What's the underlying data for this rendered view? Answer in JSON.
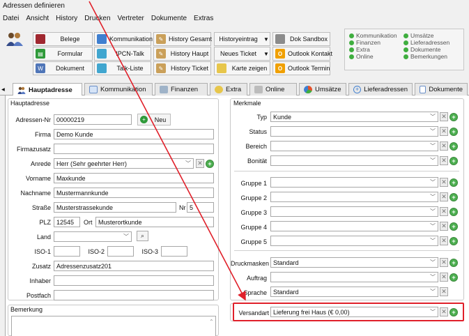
{
  "window": {
    "title": "Adressen definieren"
  },
  "menu": [
    "Datei",
    "Ansicht",
    "History",
    "Drucken",
    "Vertreter",
    "Dokumente",
    "Extras"
  ],
  "toolbar": {
    "buttons": [
      {
        "label": "Belege",
        "icon": "book-icon"
      },
      {
        "label": "Formular",
        "icon": "printer-icon"
      },
      {
        "label": "Dokument",
        "icon": "document-icon"
      },
      {
        "label": "Kommunikation",
        "icon": "communication-icon"
      },
      {
        "label": "IPCN-Talk",
        "icon": "talk-icon"
      },
      {
        "label": "Talk-Liste",
        "icon": "list-icon"
      },
      {
        "label": "History Gesamt",
        "icon": "pen-icon"
      },
      {
        "label": "History Haupt",
        "icon": "pen-icon"
      },
      {
        "label": "History Ticket",
        "icon": "pen-icon"
      },
      {
        "label": "Historyeintrag",
        "icon": ""
      },
      {
        "label": "Neues Ticket",
        "icon": ""
      },
      {
        "label": "Karte zeigen",
        "icon": "map-icon"
      },
      {
        "label": "Dok Sandbox",
        "icon": "folder-icon"
      },
      {
        "label": "Outlook Kontakt",
        "icon": "outlook-icon"
      },
      {
        "label": "Outlook Termin",
        "icon": "outlook-icon"
      }
    ]
  },
  "legend": {
    "left": [
      "Kommunikation",
      "Finanzen",
      "Extra",
      "Online"
    ],
    "right": [
      "Umsätze",
      "Lieferadressen",
      "Dokumente",
      "Bemerkungen"
    ]
  },
  "tabs": [
    "Hauptadresse",
    "Kommunikation",
    "Finanzen",
    "Extra",
    "Online",
    "Umsätze",
    "Lieferadressen",
    "Dokumente"
  ],
  "hauptadresse": {
    "group_title": "Hauptadresse",
    "fields": {
      "adressnr_label": "Adressen-Nr",
      "adressnr_value": "00000219",
      "neu_button": "Neu",
      "firma_label": "Firma",
      "firma_value": "Demo Kunde",
      "firmazusatz_label": "Firmazusatz",
      "firmazusatz_value": "",
      "anrede_label": "Anrede",
      "anrede_value": "Herr (Sehr geehrter Herr)",
      "vorname_label": "Vorname",
      "vorname_value": "Maxkunde",
      "nachname_label": "Nachname",
      "nachname_value": "Mustermannkunde",
      "strasse_label": "Straße",
      "strasse_value": "Musterstrassekunde",
      "nr_label": "Nr",
      "nr_value": "5",
      "plz_label": "PLZ",
      "plz_value": "12545",
      "ort_label": "Ort",
      "ort_value": "Musterortkunde",
      "land_label": "Land",
      "land_value": "",
      "iso1_label": "ISO-1",
      "iso2_label": "ISO-2",
      "iso3_label": "ISO-3",
      "zusatz_label": "Zusatz",
      "zusatz_value": "Adressenzusatz201",
      "inhaber_label": "Inhaber",
      "inhaber_value": "",
      "postfach_label": "Postfach",
      "postfach_value": ""
    }
  },
  "bemerkung": {
    "group_title": "Bemerkung"
  },
  "merkmale": {
    "group_title": "Merkmale",
    "typ_label": "Typ",
    "typ_value": "Kunde",
    "status_label": "Status",
    "bereich_label": "Bereich",
    "bonitaet_label": "Bonität",
    "gruppe1_label": "Gruppe 1",
    "gruppe2_label": "Gruppe 2",
    "gruppe3_label": "Gruppe 3",
    "gruppe4_label": "Gruppe 4",
    "gruppe5_label": "Gruppe 5",
    "druckmasken_label": "Druckmasken",
    "druckmasken_value": "Standard",
    "auftrag_label": "Auftrag",
    "sprache_label": "Sprache",
    "sprache_value": "Standard",
    "versandart_label": "Versandart",
    "versandart_value": "Lieferung frei Haus  (€ 0,00)"
  },
  "colors": {
    "highlight": "#e0202a",
    "legend_dot": "#3fae3f"
  }
}
